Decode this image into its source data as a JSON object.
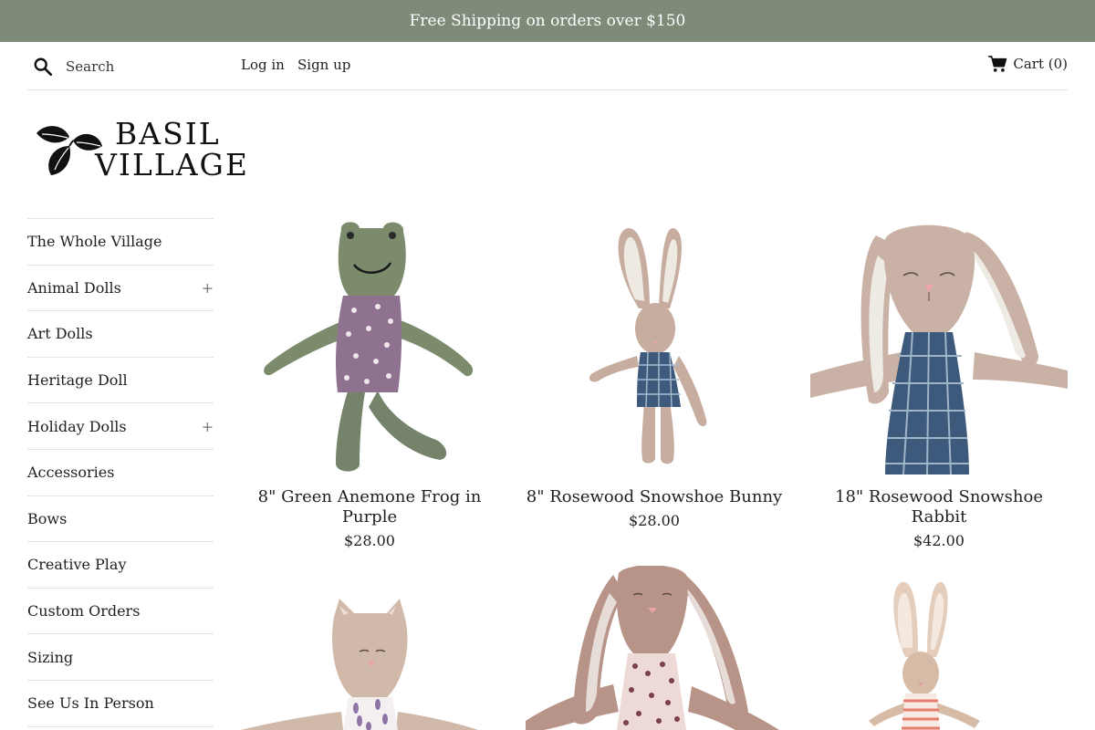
{
  "announcement": "Free Shipping on orders over $150",
  "header": {
    "search_placeholder": "Search",
    "login": "Log in",
    "signup": "Sign up",
    "cart": "Cart (0)"
  },
  "logo": {
    "line1": "BASIL",
    "line2": "VILLAGE"
  },
  "sidebar": {
    "items": [
      {
        "label": "The Whole Village",
        "expandable": false
      },
      {
        "label": "Animal Dolls",
        "expandable": true,
        "toggle": "+"
      },
      {
        "label": "Art Dolls",
        "expandable": false
      },
      {
        "label": "Heritage Doll",
        "expandable": false
      },
      {
        "label": "Holiday Dolls",
        "expandable": true,
        "toggle": "+"
      },
      {
        "label": "Accessories",
        "expandable": false
      },
      {
        "label": "Bows",
        "expandable": false
      },
      {
        "label": "Creative Play",
        "expandable": false
      },
      {
        "label": "Custom Orders",
        "expandable": false
      },
      {
        "label": "Sizing",
        "expandable": false
      },
      {
        "label": "See Us In Person",
        "expandable": false
      }
    ]
  },
  "products": [
    {
      "title": "8\" Green Anemone Frog in Purple",
      "price": "$28.00"
    },
    {
      "title": "8\" Rosewood Snowshoe Bunny",
      "price": "$28.00"
    },
    {
      "title": "18\" Rosewood Snowshoe Rabbit",
      "price": "$42.00"
    },
    {
      "title": "",
      "price": ""
    },
    {
      "title": "",
      "price": ""
    },
    {
      "title": "",
      "price": ""
    }
  ],
  "colors": {
    "announcement_bg": "#7d8b78",
    "frog_green": "#7c8b6c",
    "frog_dress": "#8e7290",
    "bunny_linen": "#c6ada0",
    "plaid_blue": "#3d5a7c"
  },
  "icons": {
    "search": "search-icon",
    "cart": "cart-icon",
    "logo": "basil-leaves-icon"
  }
}
